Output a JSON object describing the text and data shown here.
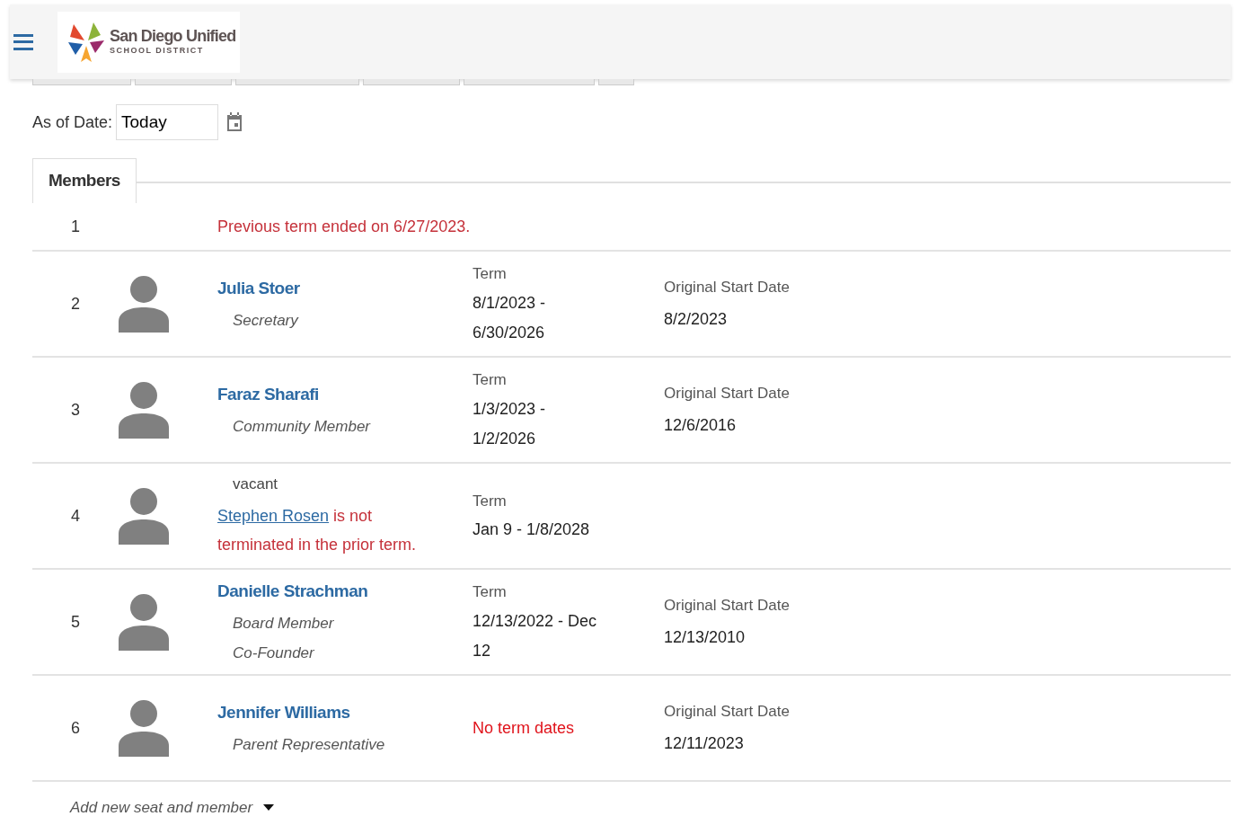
{
  "header": {
    "logo": {
      "title": "San Diego Unified",
      "subtitle": "SCHOOL DISTRICT"
    }
  },
  "as_of_date": {
    "label": "As of Date:",
    "value": "Today"
  },
  "section_tab": {
    "label": "Members",
    "selected": true
  },
  "rows": [
    {
      "kind": "note",
      "number": "1",
      "message": "Previous term ended on 6/27/2023."
    },
    {
      "kind": "member",
      "number": "2",
      "name": "Julia Stoer",
      "roles": [
        "Secretary"
      ],
      "term": {
        "kind": "range",
        "label": "Term",
        "lines": [
          "8/1/2023 -",
          "6/30/2026"
        ]
      },
      "original_start": {
        "label": "Original Start Date",
        "value": "8/2/2023"
      }
    },
    {
      "kind": "member",
      "number": "3",
      "name": "Faraz Sharafi",
      "roles": [
        "Community Member"
      ],
      "term": {
        "kind": "range",
        "label": "Term",
        "lines": [
          "1/3/2023 -",
          "1/2/2026"
        ]
      },
      "original_start": {
        "label": "Original Start Date",
        "value": "12/6/2016"
      }
    },
    {
      "kind": "vacant",
      "number": "4",
      "status": "vacant",
      "warning_link": "Stephen Rosen",
      "warning_text": " is not terminated in the prior term.",
      "term": {
        "kind": "range",
        "label": "Term",
        "lines": [
          "Jan 9 - 1/8/2028"
        ]
      }
    },
    {
      "kind": "member",
      "number": "5",
      "name": "Danielle Strachman",
      "roles": [
        "Board Member",
        "Co-Founder"
      ],
      "term": {
        "kind": "range",
        "label": "Term",
        "lines": [
          "12/13/2022 - Dec",
          "12"
        ]
      },
      "original_start": {
        "label": "Original Start Date",
        "value": "12/13/2010"
      }
    },
    {
      "kind": "member",
      "number": "6",
      "name": "Jennifer Williams",
      "roles": [
        "Parent Representative"
      ],
      "term": {
        "kind": "none",
        "message": "No term dates"
      },
      "original_start": {
        "label": "Original Start Date",
        "value": "12/11/2023"
      }
    }
  ],
  "add_seat": {
    "label": "Add new seat and member"
  }
}
